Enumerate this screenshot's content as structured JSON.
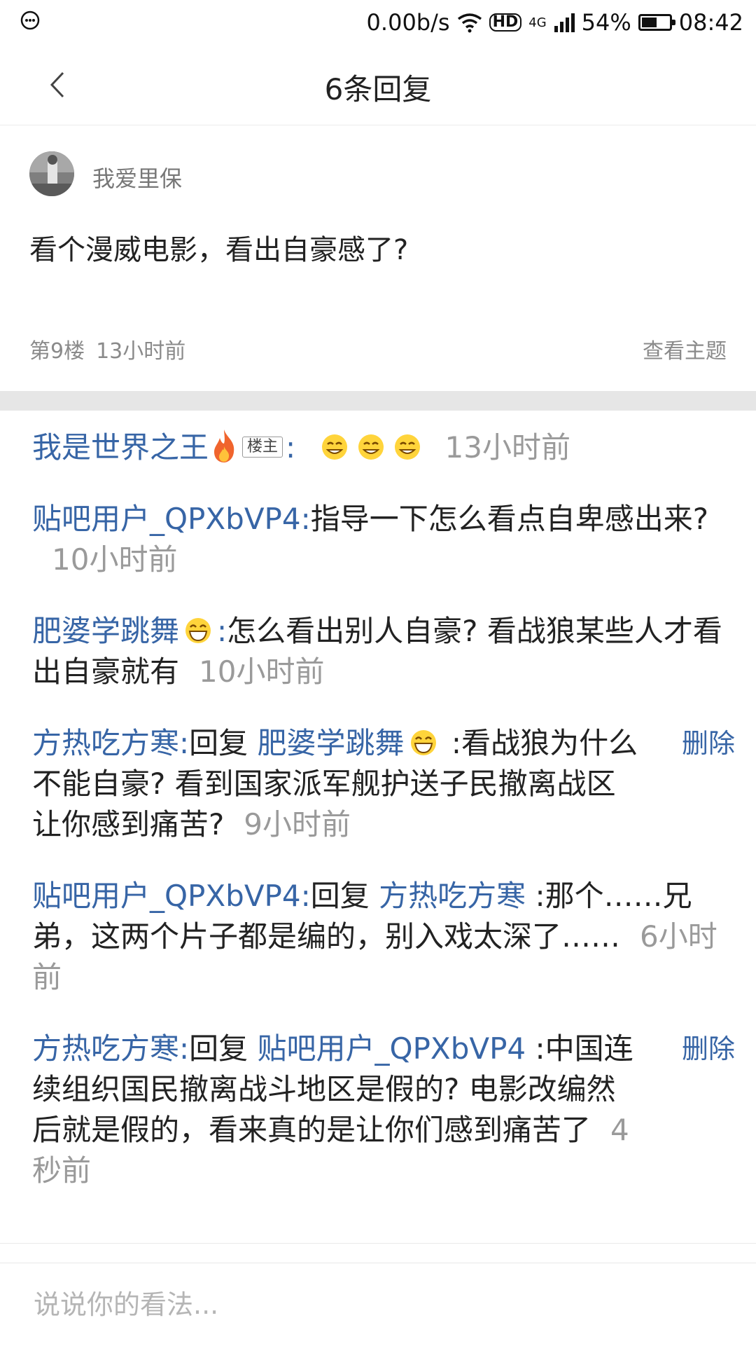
{
  "status_bar": {
    "speed": "0.00b/s",
    "network": "4G",
    "hd_label": "HD",
    "battery_percent": "54%",
    "battery_level": 0.54,
    "time": "08:42"
  },
  "header": {
    "title": "6条回复"
  },
  "post": {
    "username": "我爱里保",
    "text": "看个漫威电影，看出自豪感了?",
    "floor": "第9楼",
    "time": "13小时前",
    "view_topic": "查看主题"
  },
  "replies": [
    {
      "author": "我是世界之王",
      "badge": "楼主",
      "colon": ":",
      "time": "13小时前"
    },
    {
      "author": "贴吧用户_QPXbVP4",
      "colon": ":",
      "text": "指导一下怎么看点自卑感出来?",
      "time": "10小时前"
    },
    {
      "author": "肥婆学跳舞",
      "colon": ":",
      "text": "怎么看出别人自豪? 看战狼某些人才看出自豪就有",
      "time": "10小时前"
    },
    {
      "author": "方热吃方寒",
      "colon": ":",
      "reply_word": "回复",
      "reply_to": "肥婆学跳舞",
      "text": ":看战狼为什么不能自豪? 看到国家派军舰护送子民撤离战区让你感到痛苦?",
      "time": "9小时前",
      "delete": "删除"
    },
    {
      "author": "贴吧用户_QPXbVP4",
      "colon": ":",
      "reply_word": "回复",
      "reply_to": "方热吃方寒",
      "text": ":那个……兄弟，这两个片子都是编的，别入戏太深了……",
      "time": "6小时前"
    },
    {
      "author": "方热吃方寒",
      "colon": ":",
      "reply_word": "回复",
      "reply_to": "贴吧用户_QPXbVP4",
      "text": ":中国连续组织国民撤离战斗地区是假的? 电影改编然后就是假的，看来真的是让你们感到痛苦了",
      "time": "4秒前",
      "delete": "删除"
    }
  ],
  "input": {
    "placeholder": "说说你的看法..."
  },
  "icons": {
    "emoji_laugh": "laugh-emoji-icon",
    "emoji_smile": "smile-emoji-icon",
    "fire": "fire-icon",
    "back": "back-arrow-icon"
  },
  "colors": {
    "link_blue": "#3765a6",
    "meta_gray": "#9a9a9a",
    "divider": "#e6e6e6"
  }
}
